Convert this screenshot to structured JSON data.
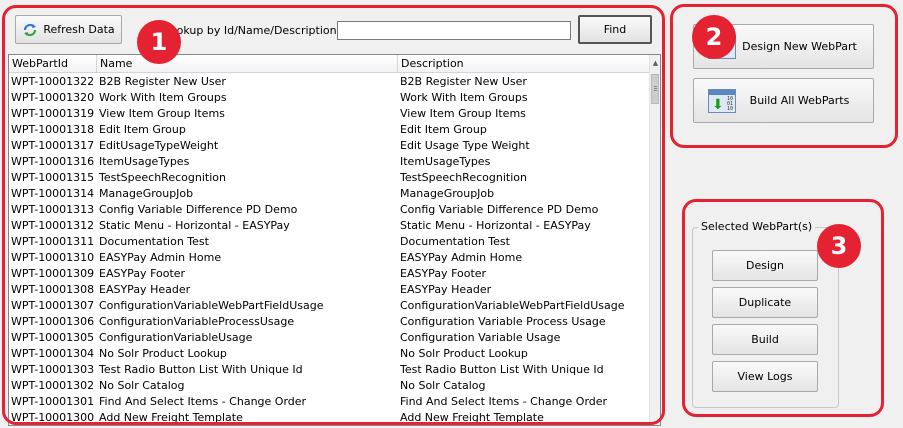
{
  "toolbar": {
    "refresh_label": "Refresh Data",
    "lookup_label": "Lookup by Id/Name/Description:",
    "lookup_value": "",
    "find_label": "Find"
  },
  "grid": {
    "columns": [
      "WebPartId",
      "Name",
      "Description"
    ],
    "rows": [
      [
        "WPT-10001322",
        "B2B Register New User",
        "B2B Register New User"
      ],
      [
        "WPT-10001320",
        "Work With Item Groups",
        "Work With Item Groups"
      ],
      [
        "WPT-10001319",
        "View Item Group Items",
        "View Item Group Items"
      ],
      [
        "WPT-10001318",
        "Edit Item Group",
        "Edit Item Group"
      ],
      [
        "WPT-10001317",
        "EditUsageTypeWeight",
        "Edit Usage Type Weight"
      ],
      [
        "WPT-10001316",
        "ItemUsageTypes",
        "ItemUsageTypes"
      ],
      [
        "WPT-10001315",
        "TestSpeechRecognition",
        "TestSpeechRecognition"
      ],
      [
        "WPT-10001314",
        "ManageGroupJob",
        "ManageGroupJob"
      ],
      [
        "WPT-10001313",
        "Config Variable Difference PD Demo",
        "Config Variable Difference PD Demo"
      ],
      [
        "WPT-10001312",
        "Static Menu - Horizontal - EASYPay",
        "Static Menu - Horizontal - EASYPay"
      ],
      [
        "WPT-10001311",
        "Documentation Test",
        "Documentation Test"
      ],
      [
        "WPT-10001310",
        "EASYPay Admin Home",
        "EASYPay Admin Home"
      ],
      [
        "WPT-10001309",
        "EASYPay Footer",
        "EASYPay Footer"
      ],
      [
        "WPT-10001308",
        "EASYPay Header",
        "EASYPay Header"
      ],
      [
        "WPT-10001307",
        "ConfigurationVariableWebPartFieldUsage",
        "ConfigurationVariableWebPartFieldUsage"
      ],
      [
        "WPT-10001306",
        "ConfigurationVariableProcessUsage",
        "Configuration Variable Process Usage"
      ],
      [
        "WPT-10001305",
        "ConfigurationVariableUsage",
        "Configuration Variable Usage"
      ],
      [
        "WPT-10001304",
        "No Solr Product Lookup",
        "No Solr Product Lookup"
      ],
      [
        "WPT-10001303",
        "Test Radio Button List With Unique Id",
        "Test Radio Button List With Unique Id"
      ],
      [
        "WPT-10001302",
        "No Solr  Catalog",
        "No Solr  Catalog"
      ],
      [
        "WPT-10001301",
        "Find And Select Items - Change Order",
        "Find And Select Items - Change Order"
      ],
      [
        "WPT-10001300",
        "Add New Freight Template",
        "Add New Freight Template"
      ]
    ]
  },
  "side": {
    "design_new_label": "Design New WebPart",
    "build_all_label": "Build All WebParts"
  },
  "selected": {
    "group_label": "Selected WebPart(s)",
    "design_label": "Design",
    "duplicate_label": "Duplicate",
    "build_label": "Build",
    "view_logs_label": "View Logs"
  },
  "callouts": [
    "1",
    "2",
    "3"
  ],
  "colors": {
    "callout_red": "#e52231"
  },
  "icons": [
    "refresh-icon",
    "design-webpart-icon",
    "build-webparts-icon",
    "scroll-up-arrow-icon"
  ]
}
